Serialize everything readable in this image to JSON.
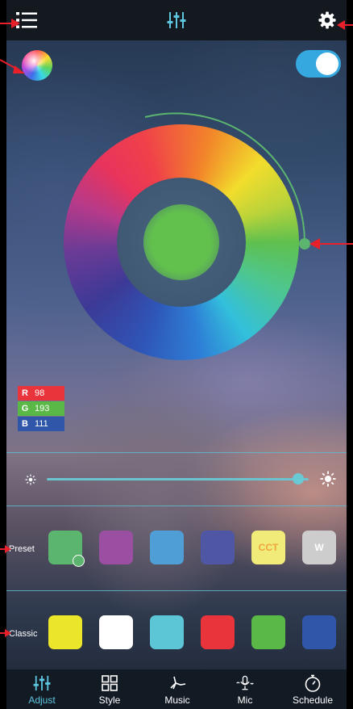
{
  "brightness": {
    "level": 0.96
  },
  "rgb": [
    {
      "key": "R",
      "value": "98"
    },
    {
      "key": "G",
      "value": "193"
    },
    {
      "key": "B",
      "value": "111"
    }
  ],
  "power_on": true,
  "current_color": "#62c14d",
  "preset": {
    "label": "Preset",
    "swatches": [
      {
        "color": "#5cb56f",
        "text": "",
        "selected": true
      },
      {
        "color": "#9a4fa3",
        "text": "",
        "selected": false
      },
      {
        "color": "#4f9fd6",
        "text": "",
        "selected": false
      },
      {
        "color": "#4f56a4",
        "text": "",
        "selected": false
      },
      {
        "color": "#f1eb7a",
        "text": "CCT",
        "text_color": "#f0a43c",
        "selected": false
      },
      {
        "color": "#cdcdcd",
        "text": "W",
        "text_color": "#ffffff",
        "selected": false
      }
    ]
  },
  "classic": {
    "label": "Classic",
    "swatches": [
      {
        "color": "#ece62a"
      },
      {
        "color": "#ffffff"
      },
      {
        "color": "#5cc6d6"
      },
      {
        "color": "#e8343a"
      },
      {
        "color": "#5ab946"
      },
      {
        "color": "#2f56a8"
      }
    ]
  },
  "nav": {
    "items": [
      {
        "label": "Adjust",
        "icon": "sliders-icon",
        "active": true
      },
      {
        "label": "Style",
        "icon": "grid-icon",
        "active": false
      },
      {
        "label": "Music",
        "icon": "music-note-icon",
        "active": false
      },
      {
        "label": "Mic",
        "icon": "microphone-icon",
        "active": false
      },
      {
        "label": "Schedule",
        "icon": "timer-icon",
        "active": false
      }
    ]
  },
  "colors": {
    "accent": "#35a9df",
    "active_nav": "#5fc6e0",
    "annotation_arrow": "#e8202a",
    "slider": "#69c4cf"
  }
}
